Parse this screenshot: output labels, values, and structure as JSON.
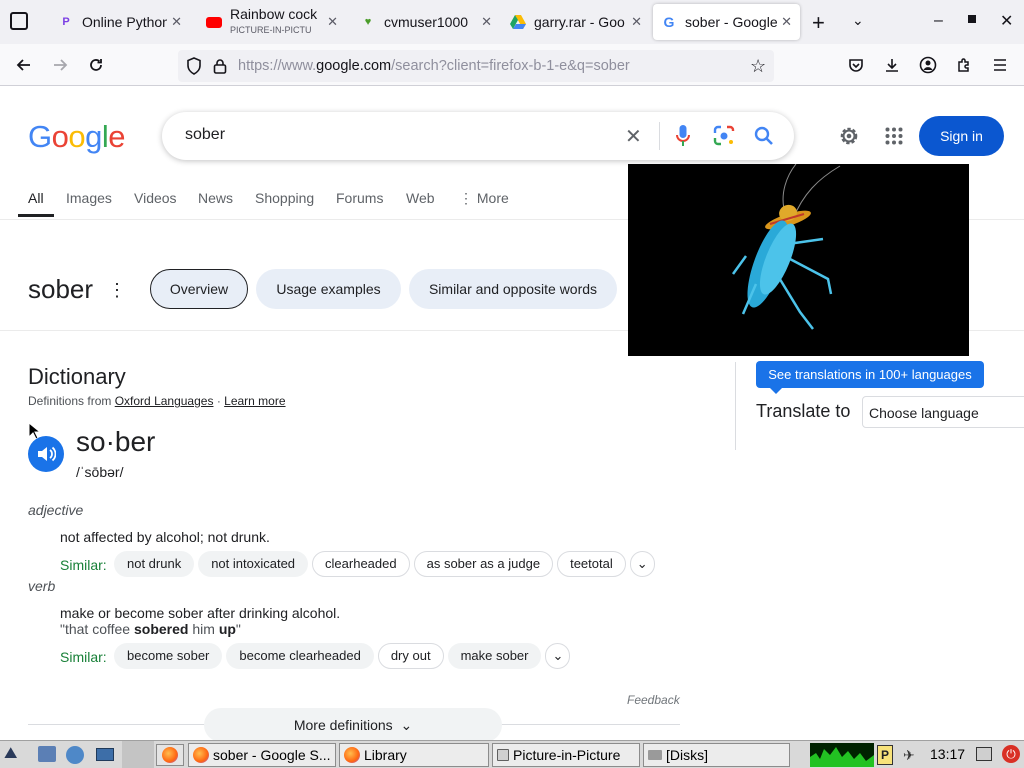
{
  "browser": {
    "tabs": [
      {
        "title": "Online Python",
        "icon": "python-icon",
        "color": "#7b3fe4"
      },
      {
        "title": "Rainbow cock",
        "subtitle": "PICTURE-IN-PICTU",
        "icon": "youtube-icon",
        "color": "#ff0000"
      },
      {
        "title": "cvmuser1000",
        "icon": "ninja-icon",
        "color": "#4b9d2a"
      },
      {
        "title": "garry.rar - Goo",
        "icon": "google-drive-icon",
        "color": "#1fa463"
      },
      {
        "title": "sober - Google",
        "icon": "google-icon",
        "color": "#4285f4",
        "active": true
      }
    ],
    "new_tab_label": "+",
    "url_prefix": "https://www.",
    "url_domain": "google.com",
    "url_path": "/search?client=firefox-b-1-e&q=sober"
  },
  "google": {
    "logo_letters": [
      {
        "ch": "G",
        "color": "#4285f4"
      },
      {
        "ch": "o",
        "color": "#ea4335"
      },
      {
        "ch": "o",
        "color": "#fbbc05"
      },
      {
        "ch": "g",
        "color": "#4285f4"
      },
      {
        "ch": "l",
        "color": "#34a853"
      },
      {
        "ch": "e",
        "color": "#ea4335"
      }
    ],
    "query": "sober",
    "sign_in": "Sign in",
    "search_tabs": [
      "All",
      "Images",
      "Videos",
      "News",
      "Shopping",
      "Forums",
      "Web"
    ],
    "more_label": "More"
  },
  "word_panel": {
    "word": "sober",
    "chips": [
      "Overview",
      "Usage examples",
      "Similar and opposite words"
    ]
  },
  "dictionary": {
    "heading": "Dictionary",
    "source_prefix": "Definitions from",
    "source_link": "Oxford Languages",
    "separator": "·",
    "learn_more": "Learn more",
    "headword": "so·ber",
    "pronunciation": "/ˈsōbər/",
    "similar_label": "Similar:",
    "senses": [
      {
        "pos": "adjective",
        "definition": "not affected by alcohol; not drunk.",
        "similar": [
          "not drunk",
          "not intoxicated",
          "clearheaded",
          "as sober as a judge",
          "teetotal"
        ]
      },
      {
        "pos": "verb",
        "definition": "make or become sober after drinking alcohol.",
        "example_pre": "\"that coffee ",
        "example_b1": "sobered",
        "example_mid": " him ",
        "example_b2": "up",
        "example_post": "\"",
        "similar": [
          "become sober",
          "become clearheaded",
          "dry out",
          "make sober"
        ]
      }
    ],
    "feedback": "Feedback",
    "more_definitions": "More definitions"
  },
  "translate": {
    "banner": "See translations in 100+ languages",
    "label": "Translate to",
    "select_value": "Choose language"
  },
  "pip": {
    "description": "cockroach-with-sombrero"
  },
  "taskbar": {
    "items": [
      {
        "label": "sober - Google S...",
        "icon": "firefox-icon"
      },
      {
        "label": "Library",
        "icon": "firefox-icon"
      },
      {
        "label": "Picture-in-Picture",
        "icon": "window-icon"
      },
      {
        "label": "[Disks]",
        "icon": "disks-icon"
      }
    ],
    "clock": "13:17"
  }
}
